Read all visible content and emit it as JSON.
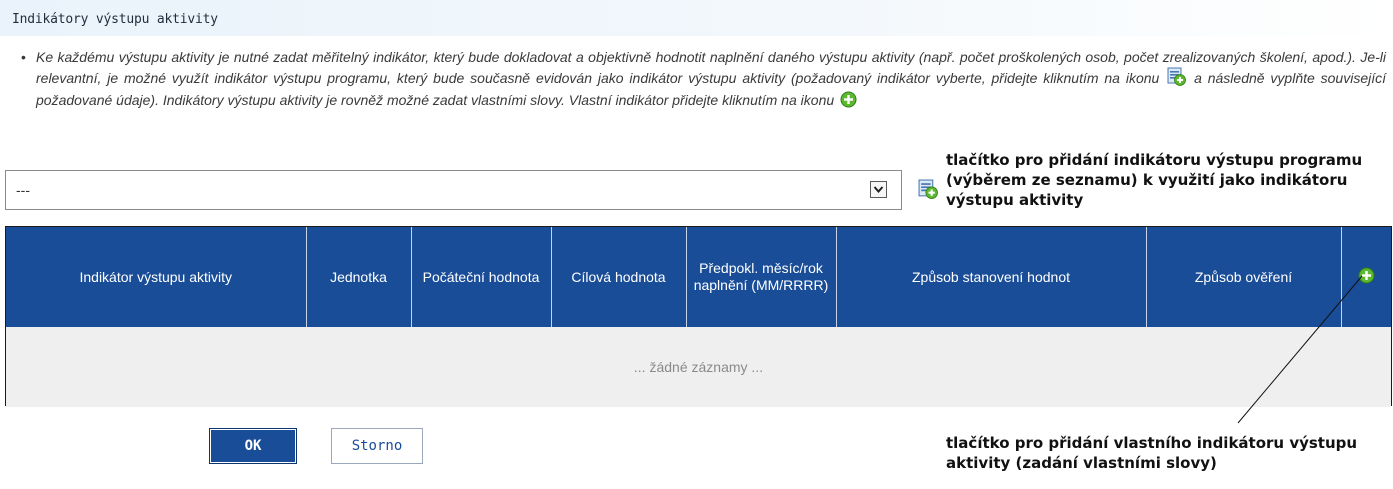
{
  "section": {
    "title": "Indikátory výstupu aktivity"
  },
  "instruction": {
    "bullet": "•",
    "part1": "Ke každému výstupu aktivity je nutné zadat měřitelný indikátor, který bude dokladovat a objektivně hodnotit naplnění daného výstupu aktivity (např. počet proškolených osob, počet zrealizovaných školení, apod.). Je-li relevantní, je možné využít indikátor výstupu programu, který bude současně evidován jako indikátor výstupu aktivity (požadovaný indikátor vyberte, přidejte kliknutím na ikonu",
    "part2": "a následně vyplňte související požadované údaje). Indikátory výstupu aktivity je rovněž možné zadat vlastními slovy. Vlastní indikátor přidejte kliknutím na ikonu"
  },
  "select": {
    "value": "---"
  },
  "annotations": {
    "program_button": "tlačítko pro přidání indikátoru výstupu programu (výběrem ze seznamu) k využití jako indikátoru výstupu aktivity",
    "own_button": "tlačítko pro přidání vlastního indikátoru výstupu aktivity (zadání vlastními slovy)"
  },
  "table": {
    "columns": [
      "Indikátor výstupu aktivity",
      "Jednotka",
      "Počáteční hodnota",
      "Cílová hodnota",
      "Předpokl. měsíc/rok naplnění (MM/RRRR)",
      "Způsob stanovení hodnot",
      "Způsob ověření"
    ],
    "empty_text": "... žádné záznamy ..."
  },
  "buttons": {
    "ok": "OK",
    "storno": "Storno"
  },
  "colors": {
    "header_blue": "#1a4d98",
    "add_green": "#5cb82e",
    "empty_row": "#efefef"
  },
  "icons": [
    "add-from-list-icon",
    "add-circle-icon",
    "dropdown-arrow-icon"
  ]
}
